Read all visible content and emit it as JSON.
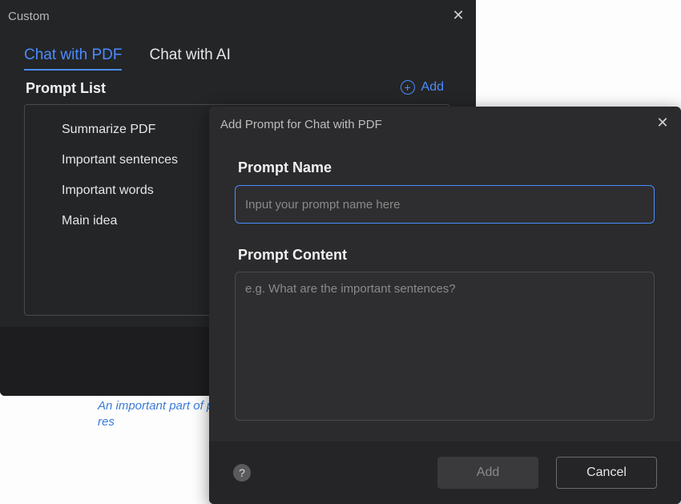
{
  "panel": {
    "title": "Custom",
    "tabs": {
      "pdf": "Chat with PDF",
      "ai": "Chat with AI"
    },
    "section": "Prompt List",
    "add_label": "Add",
    "items": [
      "Summarize PDF",
      "Important sentences",
      "Important words",
      "Main idea"
    ]
  },
  "dialog": {
    "title": "Add Prompt for Chat with PDF",
    "name_label": "Prompt Name",
    "name_placeholder": "Input your prompt name here",
    "content_label": "Prompt Content",
    "content_placeholder": "e.g. What are the important sentences?",
    "add_btn": "Add",
    "cancel_btn": "Cancel"
  },
  "background": {
    "snippet": "An important part of preserving nature is equal access to res",
    "snippet2": " "
  }
}
